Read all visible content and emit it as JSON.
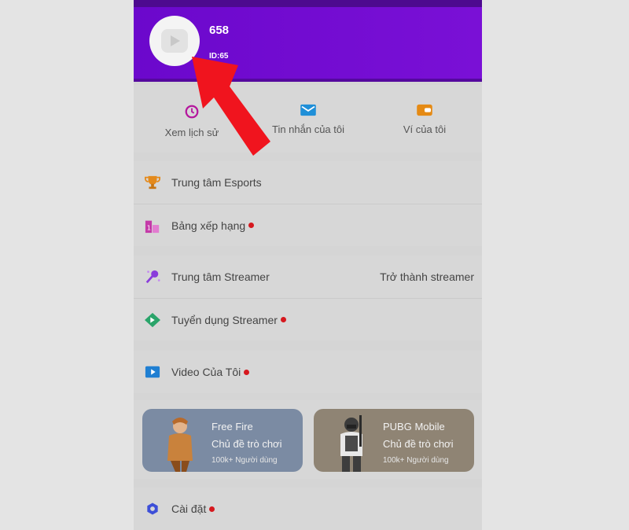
{
  "profile": {
    "username": "658",
    "user_id": "ID:65"
  },
  "quick_actions": [
    {
      "label": "Xem lịch sử",
      "icon": "clock-icon"
    },
    {
      "label": "Tin nhắn của tôi",
      "icon": "mail-icon"
    },
    {
      "label": "Ví của tôi",
      "icon": "wallet-icon"
    }
  ],
  "menu_esports": [
    {
      "label": "Trung tâm Esports",
      "icon": "trophy-icon",
      "dot": false
    },
    {
      "label": "Bảng xếp hạng",
      "icon": "leaderboard-icon",
      "dot": true
    }
  ],
  "menu_streamer": [
    {
      "label": "Trung tâm Streamer",
      "icon": "microphone-icon",
      "dot": false,
      "right": "Trở thành streamer"
    },
    {
      "label": "Tuyển dụng Streamer",
      "icon": "recruit-icon",
      "dot": true
    }
  ],
  "menu_video": {
    "label": "Video Của Tôi",
    "icon": "video-icon",
    "dot": true
  },
  "game_cards": [
    {
      "title": "Free Fire",
      "subtitle": "Chủ đề trò chơi",
      "users": "100k+ Người dùng",
      "color": "#7b8ba3"
    },
    {
      "title": "PUBG Mobile",
      "subtitle": "Chủ đề trò chơi",
      "users": "100k+ Người dùng",
      "color": "#8f8474"
    }
  ],
  "settings": {
    "label": "Cài đặt",
    "icon": "gear-icon",
    "dot": true
  },
  "colors": {
    "header": "#6b08cc",
    "accent_dot": "#d6181e",
    "annotation_arrow": "#f0141e"
  }
}
